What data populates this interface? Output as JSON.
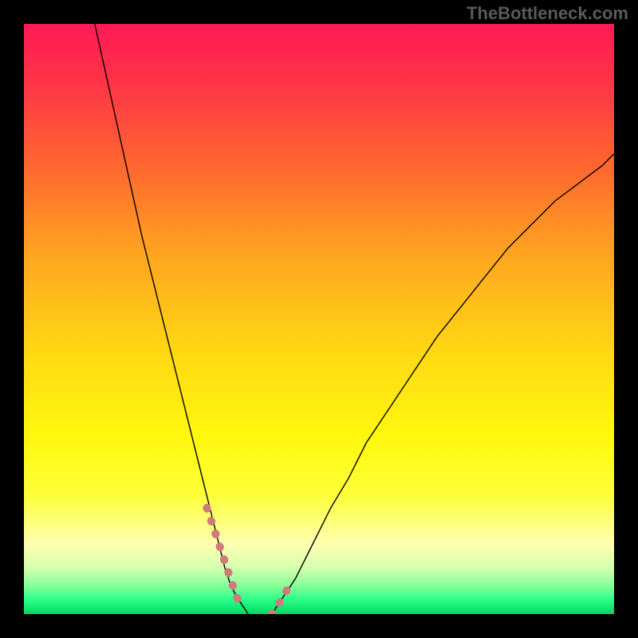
{
  "attribution": "TheBottleneck.com",
  "chart_data": {
    "type": "line",
    "title": "",
    "xlabel": "",
    "ylabel": "",
    "xlim": [
      0,
      100
    ],
    "ylim": [
      0,
      100
    ],
    "grid": false,
    "legend": false,
    "series": [
      {
        "name": "left-curve",
        "x": [
          12,
          14,
          16,
          18,
          20,
          22,
          24,
          26,
          28,
          30,
          31,
          32,
          33,
          34,
          35,
          36,
          37,
          38
        ],
        "y": [
          100,
          91,
          82,
          73,
          64,
          56,
          48,
          40,
          32,
          24,
          20,
          16,
          12,
          8,
          5,
          3,
          1.5,
          0
        ],
        "stroke": "#000000",
        "width": 1.4
      },
      {
        "name": "right-curve",
        "x": [
          42,
          44,
          46,
          48,
          50,
          52,
          55,
          58,
          62,
          66,
          70,
          74,
          78,
          82,
          86,
          90,
          94,
          98,
          100
        ],
        "y": [
          0,
          3,
          6,
          10,
          14,
          18,
          23,
          29,
          35,
          41,
          47,
          52,
          57,
          62,
          66,
          70,
          73,
          76,
          78
        ],
        "stroke": "#000000",
        "width": 1.4
      },
      {
        "name": "highlight-left",
        "x": [
          31,
          32,
          33,
          34,
          35,
          36,
          37
        ],
        "y": [
          18,
          15,
          12,
          9,
          6,
          3,
          1
        ],
        "stroke": "#d07b7b",
        "width": 10,
        "dash": "1 16",
        "cap": "round"
      },
      {
        "name": "highlight-bottom-right",
        "x": [
          42,
          43,
          44,
          45
        ],
        "y": [
          0,
          1.5,
          3,
          5
        ],
        "stroke": "#d07b7b",
        "width": 10,
        "dash": "1 16",
        "cap": "round"
      }
    ],
    "gradient_stops": [
      {
        "offset": 0.0,
        "color": "#ff1a55"
      },
      {
        "offset": 0.1,
        "color": "#ff3448"
      },
      {
        "offset": 0.25,
        "color": "#ff6a2e"
      },
      {
        "offset": 0.4,
        "color": "#ffa81f"
      },
      {
        "offset": 0.55,
        "color": "#ffd614"
      },
      {
        "offset": 0.7,
        "color": "#fff80e"
      },
      {
        "offset": 0.8,
        "color": "#fdff3a"
      },
      {
        "offset": 0.88,
        "color": "#ffffb0"
      },
      {
        "offset": 0.92,
        "color": "#d8ffb0"
      },
      {
        "offset": 0.95,
        "color": "#8dff9a"
      },
      {
        "offset": 0.975,
        "color": "#2dff8a"
      },
      {
        "offset": 1.0,
        "color": "#00d860"
      }
    ]
  }
}
